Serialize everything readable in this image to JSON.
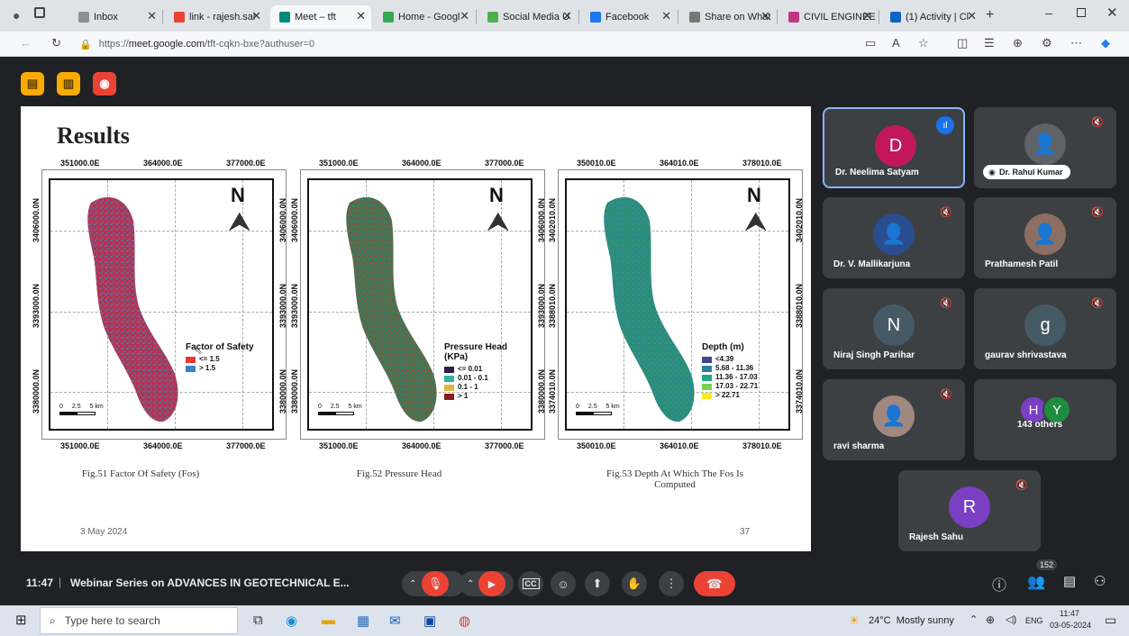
{
  "browser": {
    "tabs": [
      {
        "label": "Inbox",
        "color": "#8a8f98"
      },
      {
        "label": "link - rajesh.sal",
        "color": "#ea4335"
      },
      {
        "label": "Meet – tft",
        "color": "#00897b"
      },
      {
        "label": "Home - Googl",
        "color": "#34a853"
      },
      {
        "label": "Social Media U",
        "color": "#4caf50"
      },
      {
        "label": "Facebook",
        "color": "#1877f2"
      },
      {
        "label": "Share on What",
        "color": "#777777"
      },
      {
        "label": "CIVIL ENGINEE",
        "color": "#c13584"
      },
      {
        "label": "(1) Activity | Cl",
        "color": "#0a66c2"
      }
    ],
    "new_tab": "+",
    "url_prefix": "https://",
    "url_host": "meet.google.com",
    "url_path": "/tft-cqkn-bxe?authuser=0"
  },
  "slide": {
    "title": "Results",
    "date": "3 May 2024",
    "page_number": "37",
    "maps": [
      {
        "top_coords": [
          "351000.0E",
          "364000.0E",
          "377000.0E"
        ],
        "bottom_coords": [
          "351000.0E",
          "364000.0E",
          "377000.0E"
        ],
        "left_coords": [
          "3406000.0N",
          "3393000.0N",
          "3380000.0N"
        ],
        "right_coords": [
          "3406000.0N",
          "3393000.0N",
          "3380000.0N"
        ],
        "north": "N",
        "scale": [
          "0",
          "2.5",
          "5 km"
        ],
        "legend_title": "Factor of Safety",
        "legend_items": [
          {
            "label": "<= 1.5",
            "color": "#e53935"
          },
          {
            "label": "> 1.5",
            "color": "#3f7fc4"
          }
        ],
        "caption": "Fig.51 Factor Of Safety (Fos)"
      },
      {
        "top_coords": [
          "351000.0E",
          "364000.0E",
          "377000.0E"
        ],
        "bottom_coords": [
          "351000.0E",
          "364000.0E",
          "377000.0E"
        ],
        "left_coords": [
          "3406000.0N",
          "3393000.0N",
          "3380000.0N"
        ],
        "right_coords": [
          "3406000.0N",
          "3393000.0N",
          "3380000.0N"
        ],
        "north": "N",
        "scale": [
          "0",
          "2.5",
          "5 km"
        ],
        "legend_title": "Pressure Head (KPa)",
        "legend_items": [
          {
            "label": "<= 0.01",
            "color": "#2d1e4f"
          },
          {
            "label": "0.01 - 0.1",
            "color": "#2bb39b"
          },
          {
            "label": "0.1 - 1",
            "color": "#e6b43c"
          },
          {
            "label": "> 1",
            "color": "#8b1a1a"
          }
        ],
        "caption": "Fig.52 Pressure Head"
      },
      {
        "top_coords": [
          "350010.0E",
          "364010.0E",
          "378010.0E"
        ],
        "bottom_coords": [
          "350010.0E",
          "364010.0E",
          "378010.0E"
        ],
        "left_coords": [
          "3402010.0N",
          "3388010.0N",
          "3374010.0N"
        ],
        "right_coords": [
          "3402010.0N",
          "3388010.0N",
          "3374010.0N"
        ],
        "north": "N",
        "scale": [
          "0",
          "2.5",
          "5 km"
        ],
        "legend_title": "Depth (m)",
        "legend_items": [
          {
            "label": "<4.39",
            "color": "#3b4a8c"
          },
          {
            "label": "5.68 - 11.36",
            "color": "#2c7fa0"
          },
          {
            "label": "11.36 - 17.03",
            "color": "#22a884"
          },
          {
            "label": "17.03 - 22.71",
            "color": "#7ad151"
          },
          {
            "label": "> 22.71",
            "color": "#fde725"
          }
        ],
        "caption": "Fig.53 Depth At Which The Fos Is Computed"
      }
    ]
  },
  "participants": [
    {
      "name": "Dr. Neelima Satyam",
      "initial": "D",
      "avatar_color": "#c2185b",
      "speaking": true
    },
    {
      "name": "Dr. Rahul Kumar",
      "initial": "",
      "avatar_color": "#5f6368",
      "speaking": false,
      "pinned_label": true
    },
    {
      "name": "Dr. V. Mallikarjuna",
      "initial": "",
      "avatar_color": "#2a4d8f",
      "speaking": false
    },
    {
      "name": "Prathamesh Patil",
      "initial": "",
      "avatar_color": "#8d6e63",
      "speaking": false
    },
    {
      "name": "Niraj Singh Parihar",
      "initial": "N",
      "avatar_color": "#455a64",
      "speaking": false
    },
    {
      "name": "gaurav shrivastava",
      "initial": "g",
      "avatar_color": "#455a64",
      "speaking": false
    },
    {
      "name": "ravi sharma",
      "initial": "",
      "avatar_color": "#a1887f",
      "speaking": false
    },
    {
      "name": "143 others",
      "initial": "",
      "avatar_color": "",
      "speaking": false
    },
    {
      "name": "Rajesh Sahu",
      "initial": "R",
      "avatar_color": "#7b3fc4",
      "speaking": false
    }
  ],
  "others_badges": [
    {
      "letter": "H",
      "color": "#7b3fc4"
    },
    {
      "letter": "Y",
      "color": "#1e8e3e"
    }
  ],
  "meeting": {
    "time": "11:47",
    "separator": "|",
    "title": "Webinar Series on ADVANCES IN GEOTECHNICAL E...",
    "people_count": "152"
  },
  "taskbar": {
    "search_placeholder": "Type here to search",
    "weather": "24°C  Mostly sunny",
    "lang": "ENG",
    "time": "11:47",
    "date": "03-05-2024"
  },
  "colors": {
    "meet_bg": "#202124",
    "tile_bg": "#3c4043",
    "end_call": "#ea4335",
    "speaking_border": "#8ab4f8"
  }
}
